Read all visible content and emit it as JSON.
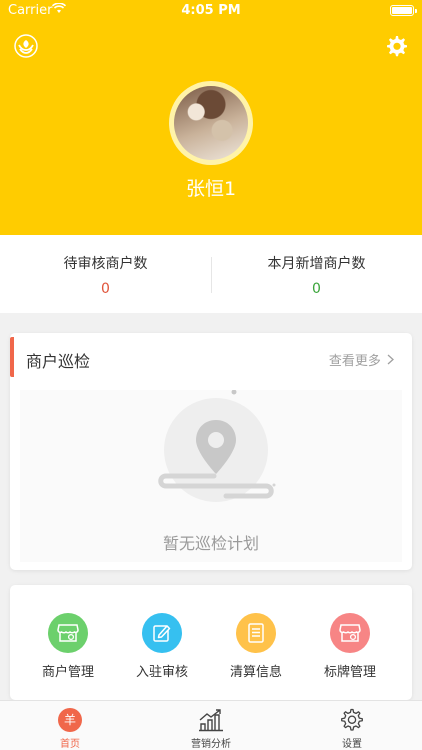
{
  "status_bar": {
    "carrier": "Carrier",
    "time": "4:05 PM"
  },
  "profile": {
    "name": "张恒1"
  },
  "stats": [
    {
      "label": "待审核商户数",
      "value": "0",
      "color": "#e0543a"
    },
    {
      "label": "本月新增商户数",
      "value": "0",
      "color": "#3aa43a"
    }
  ],
  "inspection": {
    "title": "商户巡检",
    "see_more": "查看更多",
    "empty_text": "暂无巡检计划"
  },
  "menu": [
    {
      "label": "商户管理",
      "icon": "shop-icon",
      "color": "#6cd06c"
    },
    {
      "label": "入驻审核",
      "icon": "edit-icon",
      "color": "#36c0f0"
    },
    {
      "label": "清算信息",
      "icon": "document-icon",
      "color": "#ffc24a"
    },
    {
      "label": "标牌管理",
      "icon": "signboard-icon",
      "color": "#f78585"
    }
  ],
  "tabs": [
    {
      "label": "首页",
      "icon": "home-icon",
      "active": true,
      "glyph": "羊"
    },
    {
      "label": "营销分析",
      "icon": "chart-icon",
      "active": false
    },
    {
      "label": "设置",
      "icon": "gear-icon",
      "active": false
    }
  ],
  "colors": {
    "brand_yellow": "#ffcc00",
    "accent": "#f0674a"
  }
}
